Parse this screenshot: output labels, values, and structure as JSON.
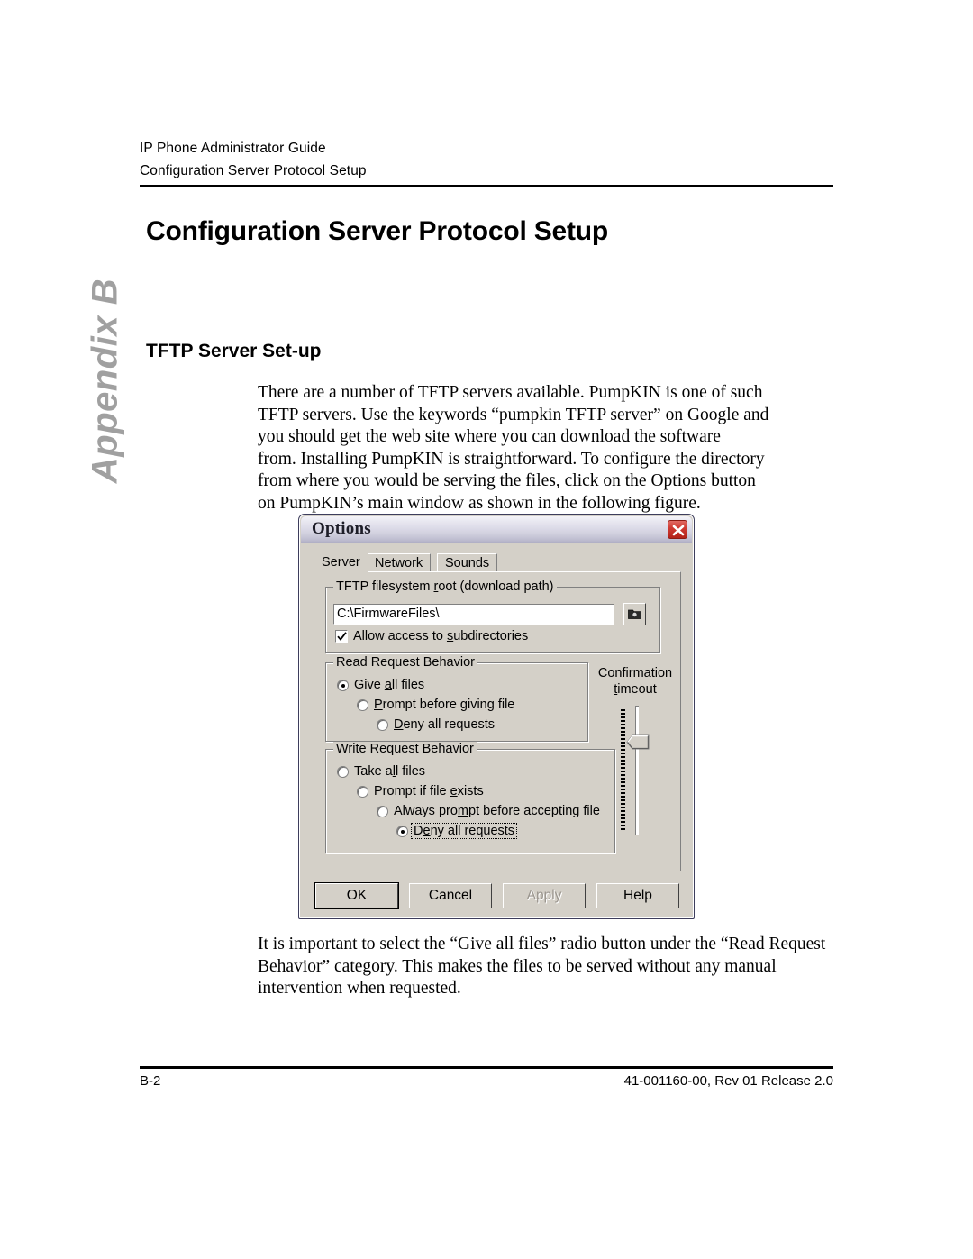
{
  "page": {
    "running_header_line1": "IP Phone Administrator Guide",
    "running_header_line2": "Configuration Server Protocol Setup",
    "chapter_title": "Configuration Server Protocol Setup",
    "appendix_tab": "Appendix B",
    "section_title": "TFTP Server Set-up",
    "paragraph_intro": [
      "There are a number of TFTP servers available. PumpKIN is one of such",
      "TFTP servers. Use the keywords “pumpkin TFTP server” on Google and",
      "you should get the web site where you can download the software",
      "from. Installing PumpKIN is straightforward. To configure the directory",
      "from where you would be serving the files, click on the Options button",
      "on PumpKIN’s main window as shown in the following figure."
    ],
    "paragraph_outro": [
      "It is important to select the “Give all files” radio button under the “Read Request",
      "Behavior” category. This makes the files to be served without any manual",
      "intervention when requested."
    ],
    "footer_left": "B-2",
    "footer_right": "41-001160-00, Rev 01  Release 2.0"
  },
  "dialog": {
    "title": "Options",
    "close_icon": "close-icon",
    "tabs": [
      {
        "label": "Server",
        "active": true
      },
      {
        "label": "Network",
        "active": false
      },
      {
        "label": "Sounds",
        "active": false
      }
    ],
    "root_group": {
      "legend_pre": "TFTP filesystem ",
      "legend_accel": "r",
      "legend_post": "oot (download path)",
      "path_value": "C:\\FirmwareFiles\\",
      "browse_icon": "folder-browse-icon",
      "checkbox": {
        "label_pre": "Allow access to ",
        "label_accel": "s",
        "label_post": "ubdirectories",
        "checked": true
      }
    },
    "read_group": {
      "legend": "Read Request Behavior",
      "options": [
        {
          "pre": "Give ",
          "accel": "a",
          "post": "ll files",
          "selected": true,
          "indent": 0
        },
        {
          "pre": "",
          "accel": "P",
          "post": "rompt before giving file",
          "selected": false,
          "indent": 1,
          "accel2": "g"
        },
        {
          "pre": "",
          "accel": "D",
          "post": "eny all requests",
          "selected": false,
          "indent": 2
        }
      ]
    },
    "write_group": {
      "legend": "Write Request Behavior",
      "options": [
        {
          "pre": "Take a",
          "accel": "l",
          "post": "l files",
          "selected": false,
          "indent": 0
        },
        {
          "pre": "Prompt if file ",
          "accel": "e",
          "post": "xists",
          "selected": false,
          "indent": 1
        },
        {
          "pre": "Always pro",
          "accel": "m",
          "post": "pt before accepting file",
          "selected": false,
          "indent": 2
        },
        {
          "pre": "D",
          "accel": "e",
          "post": "ny all requests",
          "selected": true,
          "indent": 3,
          "focused": true
        }
      ]
    },
    "timeout": {
      "label_line1": "Confirmation",
      "label_accel": "t",
      "label_line2_post": "imeout",
      "slider_name": "confirmation-timeout-slider"
    },
    "buttons": [
      {
        "label": "OK",
        "style": "default"
      },
      {
        "label": "Cancel",
        "style": "normal"
      },
      {
        "label": "Apply",
        "style": "disabled"
      },
      {
        "label": "Help",
        "style": "normal"
      }
    ]
  }
}
